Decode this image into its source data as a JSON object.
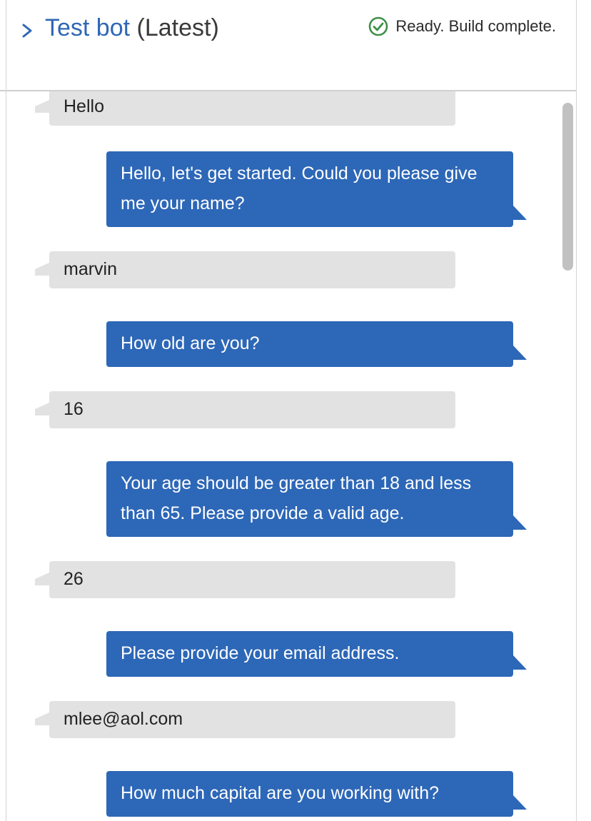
{
  "header": {
    "bot_name": "Test bot",
    "version": "(Latest)",
    "status_text": "Ready. Build complete.",
    "status_icon": "check-circle-icon",
    "expand_icon": "chevron-right-icon"
  },
  "colors": {
    "accent": "#2f67b6",
    "bot_bubble": "#2d67b7",
    "user_bubble": "#e2e2e2",
    "status_ok": "#3c8f47"
  },
  "messages": [
    {
      "from": "user",
      "text": "Hello"
    },
    {
      "from": "bot",
      "text": "Hello, let's get started. Could you please give me your name?"
    },
    {
      "from": "user",
      "text": "marvin"
    },
    {
      "from": "bot",
      "text": "How old are you?"
    },
    {
      "from": "user",
      "text": "16"
    },
    {
      "from": "bot",
      "text": "Your age should be greater than 18 and less than 65. Please provide a valid age."
    },
    {
      "from": "user",
      "text": "26"
    },
    {
      "from": "bot",
      "text": "Please provide your email address."
    },
    {
      "from": "user",
      "text": "mlee@aol.com"
    },
    {
      "from": "bot",
      "text": "How much capital are you working with?"
    }
  ]
}
